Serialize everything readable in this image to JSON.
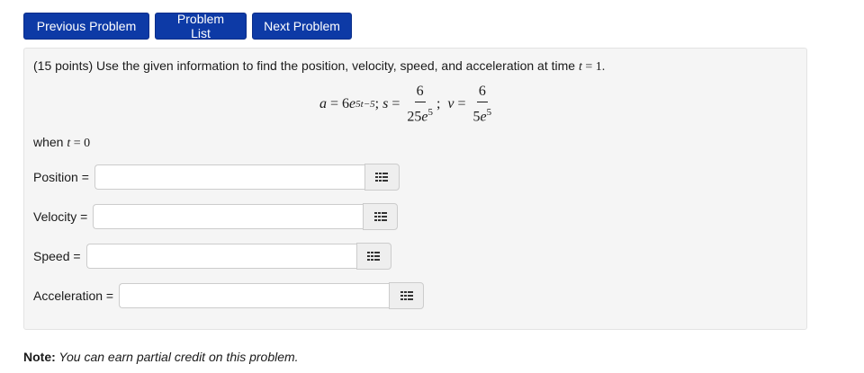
{
  "nav": {
    "previous_label": "Previous Problem",
    "list_label": "Problem List",
    "next_label": "Next Problem",
    "button_color": "#0d3aa6"
  },
  "problem": {
    "intro": "(15 points) Use the given information to find the position, velocity, speed, and acceleration at time ",
    "time_var": "t",
    "time_eq": " = ",
    "time_val": "1",
    "time_end": ".",
    "formula": {
      "a_lhs": "a",
      "eq": " = ",
      "a_coef": "6",
      "a_base": "e",
      "a_exp": "5t−5",
      "sep1": "; ",
      "s_lhs": "s",
      "s_num": "6",
      "s_den_coef": "25",
      "s_den_base": "e",
      "s_den_exp": "5",
      "sep2": ";",
      "v_lhs": "v",
      "v_num": "6",
      "v_den_coef": "5",
      "v_den_base": "e",
      "v_den_exp": "5"
    },
    "when_text": "when ",
    "when_var": "t",
    "when_eq": " = ",
    "when_val": "0"
  },
  "answers": [
    {
      "label": "Position =",
      "value": ""
    },
    {
      "label": "Velocity =",
      "value": ""
    },
    {
      "label": "Speed =",
      "value": ""
    },
    {
      "label": "Acceleration =",
      "value": ""
    }
  ],
  "note": {
    "bold": "Note:",
    "text": " You can earn partial credit on this problem."
  }
}
